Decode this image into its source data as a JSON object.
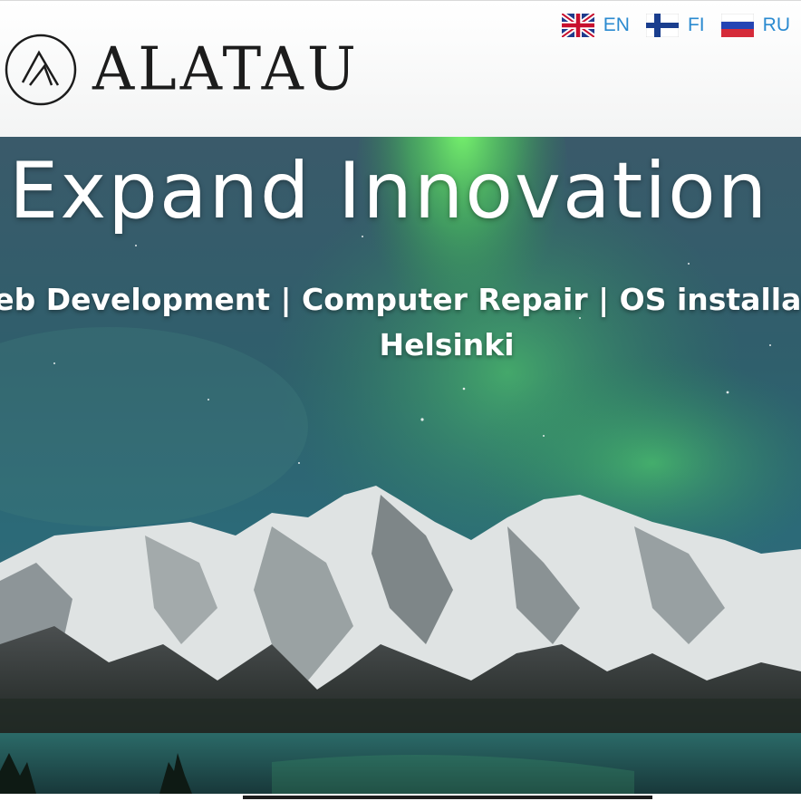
{
  "header": {
    "logo": {
      "text": "ALATAU",
      "icon": "triangle-circle-logo-icon"
    },
    "languages": [
      {
        "code": "EN",
        "flag": "uk-flag-icon"
      },
      {
        "code": "FI",
        "flag": "finland-flag-icon"
      },
      {
        "code": "RU",
        "flag": "russia-flag-icon"
      }
    ]
  },
  "hero": {
    "title": "Expand Innovation",
    "services": "Web Development | Computer Repair | OS installation",
    "city": "Helsinki",
    "background": "aurora-over-snowy-mountains-and-lake"
  },
  "colors": {
    "link_blue": "#2a8ad0",
    "logo_dark": "#1c1c1c",
    "aurora_green": "#5ef06a"
  }
}
